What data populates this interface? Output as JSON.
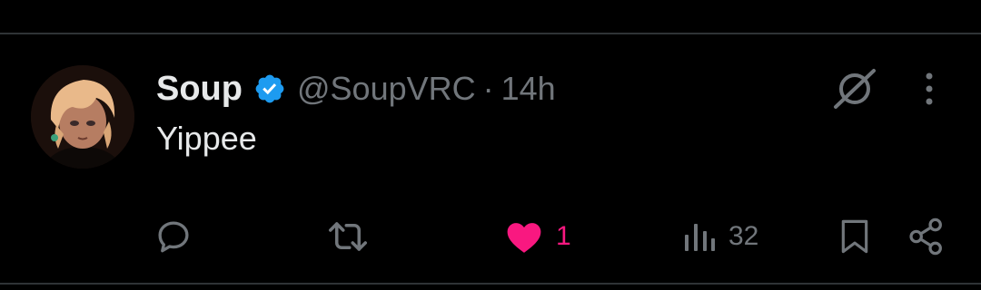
{
  "tweet": {
    "display_name": "Soup",
    "handle": "@SoupVRC",
    "separator": "·",
    "time": "14h",
    "text": "Yippee",
    "verified": true
  },
  "actions": {
    "reply": {
      "icon": "reply-icon"
    },
    "retweet": {
      "icon": "retweet-icon"
    },
    "like": {
      "icon": "heart-filled-icon",
      "count": "1",
      "liked": true
    },
    "views": {
      "icon": "views-chart-icon",
      "count": "32"
    },
    "bookmark": {
      "icon": "bookmark-icon"
    },
    "share": {
      "icon": "share-icon"
    }
  },
  "header_icons": {
    "grok": "grok-icon",
    "more": "more-vertical-icon"
  },
  "colors": {
    "background": "#000000",
    "text": "#e7e9ea",
    "muted": "#71767b",
    "like": "#f91880",
    "verified": "#1d9bf0",
    "divider": "#2f3336"
  }
}
